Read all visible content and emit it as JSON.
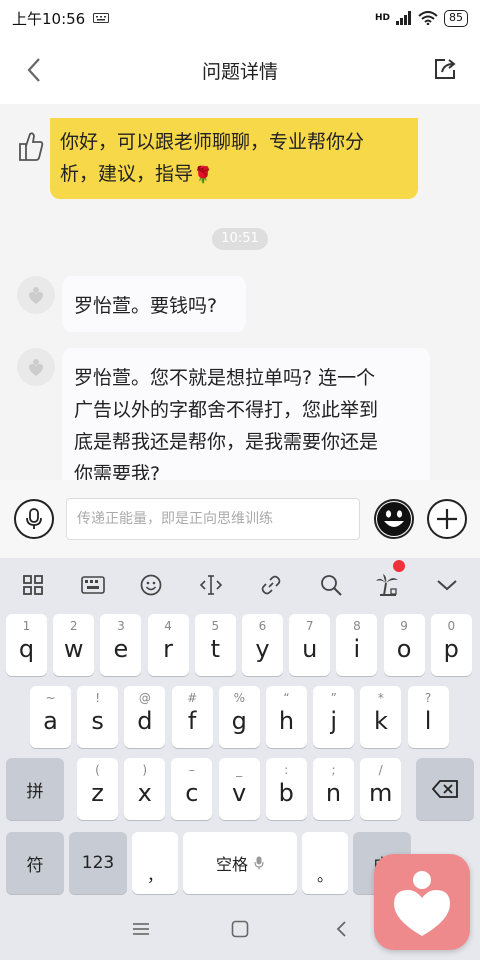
{
  "status": {
    "time": "上午10:56",
    "battery": "85",
    "network": "HD"
  },
  "header": {
    "title": "问题详情"
  },
  "chat": {
    "top_message": {
      "line1": "你好，可以跟老师聊聊，专业帮你分",
      "line2": "析，建议，指导",
      "emoji": "🌹"
    },
    "timestamp": "10:51",
    "messages": [
      {
        "text": "罗怡萱。要钱吗?"
      },
      {
        "line1": "罗怡萱。您不就是想拉单吗? 连一个",
        "line2": "广告以外的字都舍不得打，您此举到",
        "line3": "底是帮我还是帮你，是我需要你还是",
        "line4": "你需要我?"
      }
    ]
  },
  "input": {
    "placeholder": "传递正能量，即是正向思维训练"
  },
  "keyboard": {
    "row1": [
      {
        "hint": "1",
        "key": "q"
      },
      {
        "hint": "2",
        "key": "w"
      },
      {
        "hint": "3",
        "key": "e"
      },
      {
        "hint": "4",
        "key": "r"
      },
      {
        "hint": "5",
        "key": "t"
      },
      {
        "hint": "6",
        "key": "y"
      },
      {
        "hint": "7",
        "key": "u"
      },
      {
        "hint": "8",
        "key": "i"
      },
      {
        "hint": "9",
        "key": "o"
      },
      {
        "hint": "0",
        "key": "p"
      }
    ],
    "row2": [
      {
        "hint": "~",
        "key": "a"
      },
      {
        "hint": "!",
        "key": "s"
      },
      {
        "hint": "@",
        "key": "d"
      },
      {
        "hint": "#",
        "key": "f"
      },
      {
        "hint": "%",
        "key": "g"
      },
      {
        "hint": "“",
        "key": "h"
      },
      {
        "hint": "”",
        "key": "j"
      },
      {
        "hint": "*",
        "key": "k"
      },
      {
        "hint": "?",
        "key": "l"
      }
    ],
    "row3": [
      {
        "hint": "(",
        "key": "z"
      },
      {
        "hint": ")",
        "key": "x"
      },
      {
        "hint": "–",
        "key": "c"
      },
      {
        "hint": "_",
        "key": "v"
      },
      {
        "hint": ":",
        "key": "b"
      },
      {
        "hint": ";",
        "key": "n"
      },
      {
        "hint": "/",
        "key": "m"
      }
    ],
    "pinyin_key": "拼",
    "symbol_key": "符",
    "num_key": "123",
    "comma_key": "，",
    "space_key": "空格",
    "period_key": "。",
    "lang_key": "中"
  }
}
